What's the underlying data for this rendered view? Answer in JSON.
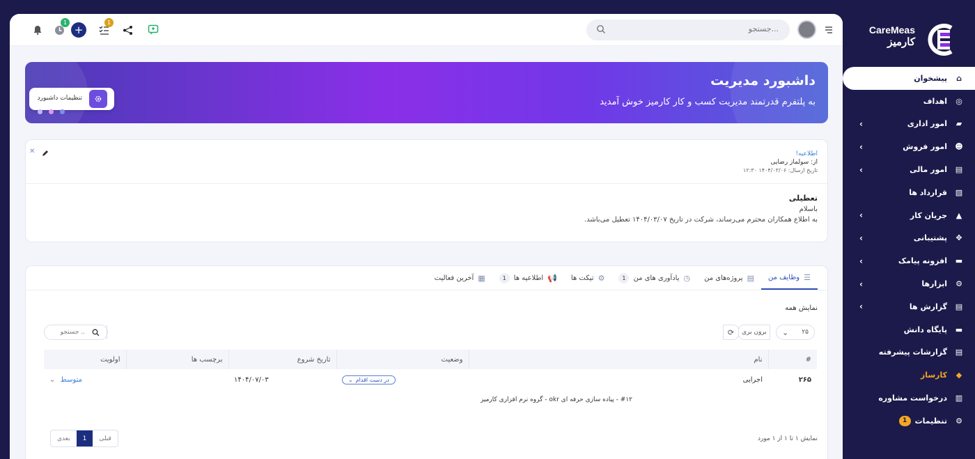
{
  "brand": {
    "name_en": "CareMeas",
    "name_fa": "کارمیز"
  },
  "sidebar": {
    "items": [
      {
        "label": "پیشخوان",
        "icon": "home-icon",
        "active": true,
        "chevron": false
      },
      {
        "label": "اهداف",
        "icon": "target-icon",
        "chevron": false
      },
      {
        "label": "امور اداری",
        "icon": "briefcase-icon",
        "chevron": true
      },
      {
        "label": "امور فروش",
        "icon": "users-icon",
        "chevron": true
      },
      {
        "label": "امور مالی",
        "icon": "ledger-icon",
        "chevron": true
      },
      {
        "label": "قرارداد ها",
        "icon": "contract-icon",
        "chevron": false
      },
      {
        "label": "جریان کار",
        "icon": "workflow-icon",
        "chevron": true
      },
      {
        "label": "پشتیبانی",
        "icon": "support-icon",
        "chevron": true
      },
      {
        "label": "افزونه پیامک",
        "icon": "sms-icon",
        "chevron": true
      },
      {
        "label": "ابزارها",
        "icon": "tools-icon",
        "chevron": true
      },
      {
        "label": "گزارش ها",
        "icon": "report-icon",
        "chevron": true
      },
      {
        "label": "پایگاه دانش",
        "icon": "folder-icon",
        "chevron": false
      },
      {
        "label": "گزارشات پیشرفته",
        "icon": "advanced-report-icon",
        "chevron": false
      },
      {
        "label": "کارساز",
        "icon": "tag-icon",
        "highlight": true,
        "chevron": false
      },
      {
        "label": "درخواست مشاوره",
        "icon": "bank-icon",
        "chevron": false
      },
      {
        "label": "تنظیمات",
        "icon": "gear-icon",
        "badge": "1",
        "chevron": false
      }
    ]
  },
  "topbar": {
    "search_placeholder": "جستجو...",
    "notif_badges": {
      "timer": "1",
      "tasks": "1"
    }
  },
  "banner": {
    "title": "داشبورد مدیریت",
    "subtitle": "به پلتفرم قدرتمند مدیریت کسب و کار کارمیز خوش آمدید",
    "settings_label": "تنظیمات داشبورد"
  },
  "announcement": {
    "title": "اطلاعیه!",
    "from": "از: سولماز رضایی",
    "sent": "تاریخ ارسال: ۱۴۰۴/۰۳/۰۶ ۱۲:۳۰",
    "body_title": "تعطیلی",
    "greeting": "باسلام",
    "body": "به اطلاع همکاران محترم می‌رساند، شرکت در تاریخ ۱۴۰۴/۰۳/۰۷ تعطیل می‌باشد."
  },
  "tabs": [
    {
      "label": "وظایف من",
      "active": true,
      "icon": "☰"
    },
    {
      "label": "پروژه‌های من",
      "icon": "▤"
    },
    {
      "label": "یادآوری های من",
      "icon": "◷",
      "count": "1"
    },
    {
      "label": "تیکت ها",
      "icon": "⚙"
    },
    {
      "label": "اطلاعیه ها",
      "icon": "📢",
      "count": "1"
    },
    {
      "label": "آخرین فعالیت",
      "icon": "▦"
    }
  ],
  "tasks": {
    "show_all": "نمایش همه",
    "page_size": "۲۵",
    "export_label": "برون بری",
    "search_placeholder": "جستجو ..",
    "columns": {
      "id": "#",
      "name": "نام",
      "status": "وضعیت",
      "start": "تاریخ شروع",
      "tags": "برچسب ها",
      "priority": "اولویت"
    },
    "rows": [
      {
        "id": "۲۶۵",
        "name": "اجرایی",
        "status": "در دست اقدام",
        "start": "۱۴۰۴/۰۷/۰۳",
        "tags": "",
        "priority": "متوسط"
      }
    ],
    "subtask": "#۱۲ - پیاده سازی حرفه ای okr - گروه نرم افزاری کارمیز",
    "summary": "نمایش ۱ تا ۱ از ۱ مورد",
    "pager": {
      "prev": "قبلی",
      "page": "1",
      "next": "بعدی"
    }
  },
  "colors": {
    "sidebar": "#1c1a4a",
    "accent": "#2d4fb8",
    "highlight": "#f5a623",
    "banner_from": "#4a3bb5",
    "banner_to": "#8a2fe8"
  }
}
